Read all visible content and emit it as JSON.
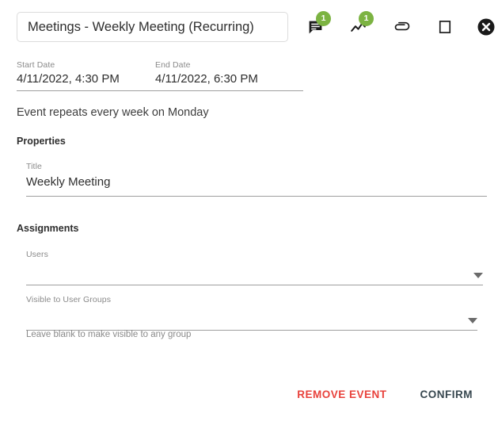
{
  "header": {
    "event_title": "Meetings - Weekly Meeting (Recurring)",
    "icons": [
      {
        "name": "comment-icon",
        "badge": "1"
      },
      {
        "name": "trend-line-icon",
        "badge": "1"
      },
      {
        "name": "attachment-icon",
        "badge": null
      },
      {
        "name": "square-icon",
        "badge": null
      },
      {
        "name": "close-circle-icon",
        "badge": null
      }
    ]
  },
  "dates": {
    "start_label": "Start Date",
    "start_value": "4/11/2022, 4:30 PM",
    "end_label": "End Date",
    "end_value": "4/11/2022, 6:30 PM"
  },
  "recurrence": {
    "text": "Event repeats every week on Monday"
  },
  "properties": {
    "section_label": "Properties",
    "title_label": "Title",
    "title_value": "Weekly Meeting"
  },
  "assignments": {
    "section_label": "Assignments",
    "users_label": "Users",
    "users_value": "",
    "groups_label": "Visible to User Groups",
    "groups_value": "",
    "groups_helper": "Leave blank to make visible to any group"
  },
  "footer": {
    "remove_label": "REMOVE EVENT",
    "confirm_label": "CONFIRM"
  },
  "colors": {
    "badge_green": "#7cb342",
    "remove_red": "#e8423c",
    "confirm_slate": "#37474f",
    "underline_gray": "#9e9e9e",
    "label_gray": "#8a8a8a"
  }
}
